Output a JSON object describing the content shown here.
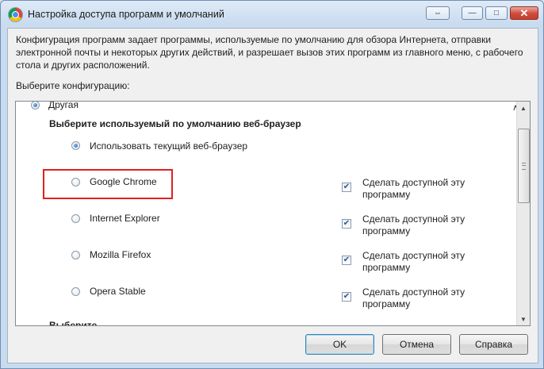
{
  "window": {
    "title": "Настройка доступа программ и умолчаний"
  },
  "description": "Конфигурация программ задает программы, используемые по умолчанию для обзора Интернета, отправки электронной почты и некоторых других действий, и разрешает вызов этих программ из главного меню, с рабочего стола и других расположений.",
  "select_label": "Выберите конфигурацию:",
  "config": {
    "name": "Другая",
    "browser_heading": "Выберите используемый по умолчанию веб-браузер",
    "current_option": "Использовать текущий веб-браузер",
    "cut_off_text": "Выберите...",
    "browsers": [
      {
        "name": "Google Chrome",
        "checkbox_label": "Сделать доступной эту программу",
        "checked": true,
        "highlighted": true
      },
      {
        "name": "Internet Explorer",
        "checkbox_label": "Сделать доступной эту программу",
        "checked": true
      },
      {
        "name": "Mozilla Firefox",
        "checkbox_label": "Сделать доступной эту программу",
        "checked": true
      },
      {
        "name": "Opera Stable",
        "checkbox_label": "Сделать доступной эту программу",
        "checked": true
      }
    ]
  },
  "buttons": {
    "ok": "OK",
    "cancel": "Отмена",
    "help": "Справка"
  },
  "icons": {
    "app": "default-programs-icon",
    "collapse": "double-chevron-up-icon",
    "check": "checkmark-icon"
  },
  "colors": {
    "highlight_box": "#e02020",
    "titlebar": "#c9dbef",
    "client_bg": "#f0f0f0"
  }
}
